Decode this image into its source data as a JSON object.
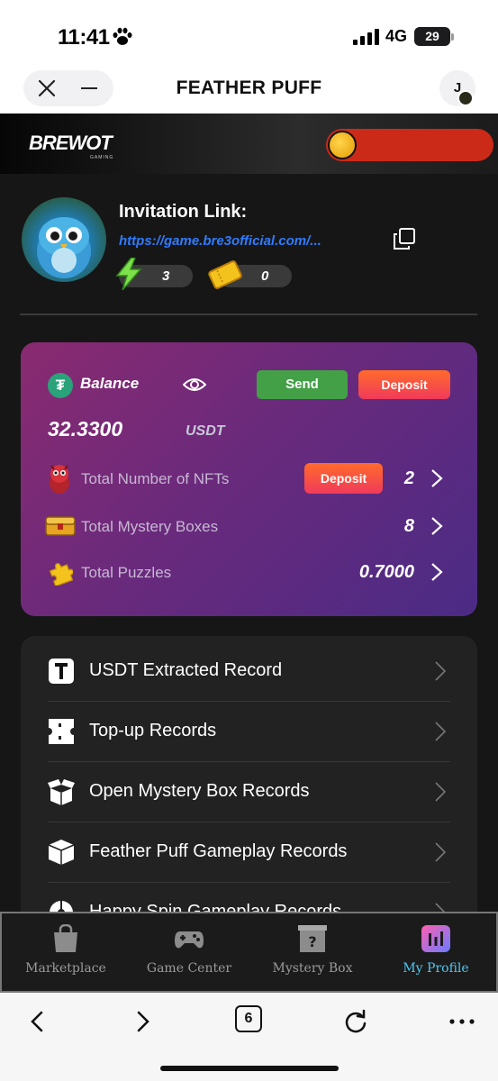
{
  "status_bar": {
    "time": "11:41",
    "network": "4G",
    "battery": "29",
    "icons": [
      "paw-icon",
      "signal-icon",
      "battery-icon"
    ]
  },
  "browser_header": {
    "title": "FEATHER PUFF",
    "avatar_initial": "J",
    "icons": [
      "close-icon",
      "minimize-icon"
    ]
  },
  "brand": {
    "logo_text": "BREWOT",
    "logo_sub": "GAMING",
    "icons": [
      "coin-icon"
    ]
  },
  "profile": {
    "invitation_label": "Invitation Link:",
    "invitation_link": "https://game.bre3official.com/...",
    "energy_count": "3",
    "ticket_count": "0",
    "icons": [
      "owl-avatar",
      "copy-icon",
      "energy-icon",
      "ticket-icon"
    ]
  },
  "balance_card": {
    "label": "Balance",
    "send_label": "Send",
    "deposit_label": "Deposit",
    "amount": "32.3300",
    "currency": "USDT",
    "rows": [
      {
        "label": "Total Number of NFTs",
        "value": "2",
        "action": "Deposit",
        "icon": "nft-icon"
      },
      {
        "label": "Total Mystery Boxes",
        "value": "8",
        "icon": "chest-icon"
      },
      {
        "label": "Total Puzzles",
        "value": "0.7000",
        "icon": "puzzle-icon"
      }
    ],
    "colors": {
      "send": "#43a047",
      "deposit": "#f03a5a",
      "card": "#6a2a7c"
    }
  },
  "records": [
    {
      "label": "USDT Extracted Record",
      "icon": "tether-box-icon"
    },
    {
      "label": "Top-up Records",
      "icon": "ticket-records-icon"
    },
    {
      "label": "Open Mystery Box Records",
      "icon": "open-box-icon"
    },
    {
      "label": "Feather Puff Gameplay Records",
      "icon": "box-icon"
    },
    {
      "label": "Happy Spin Gameplay Records",
      "icon": "spin-icon"
    }
  ],
  "tab_bar": {
    "tabs": [
      {
        "label": "Marketplace",
        "icon": "shopping-bag-icon"
      },
      {
        "label": "Game Center",
        "icon": "gamepad-icon"
      },
      {
        "label": "Mystery Box",
        "icon": "mystery-box-icon"
      },
      {
        "label": "My Profile",
        "icon": "profile-chart-icon",
        "active": true
      }
    ],
    "active_color": "#4fc8f0"
  },
  "browser_toolbar": {
    "tab_count": "6",
    "icons": [
      "back-icon",
      "forward-icon",
      "reload-icon",
      "more-icon"
    ]
  }
}
